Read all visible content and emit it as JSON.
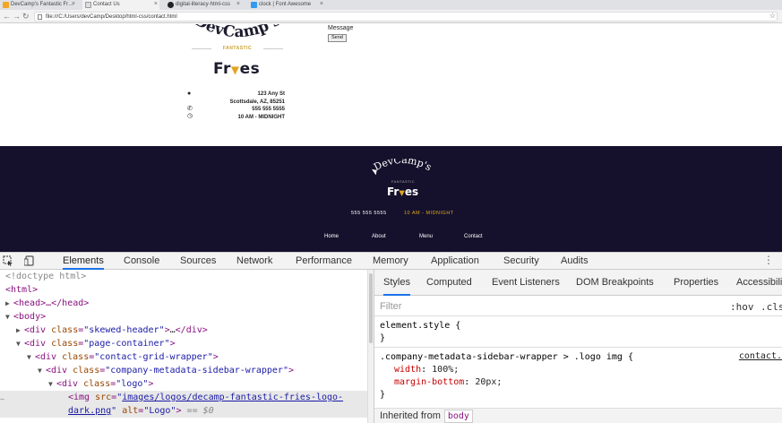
{
  "browser": {
    "tabs": [
      {
        "label": "DevCamp's Fantastic Fr…",
        "active": false
      },
      {
        "label": "Contact Us",
        "active": true
      },
      {
        "label": "digital-literacy-html-css",
        "active": false
      },
      {
        "label": "clock | Font Awesome",
        "active": false
      }
    ],
    "url": "file:///C:/Users/devCamp/Desktop/html-css/contact.html"
  },
  "page": {
    "brand_arc": "DevCamp's",
    "brand_tag": "FANTASTIC",
    "brand_main": "Fries",
    "address": [
      "123 Any St",
      "Scottsdale, AZ, 85251",
      "555 555 5555",
      "10 AM - MIDNIGHT"
    ],
    "message_label": "Message",
    "send_label": "Send",
    "footer": {
      "brand_arc": "DevCamp's",
      "brand_tag": "FANTASTIC",
      "brand_main": "Fries",
      "phone": "555 555 5555",
      "hours": "10 AM - MIDNIGHT",
      "nav": [
        "Home",
        "About",
        "Menu",
        "Contact"
      ]
    }
  },
  "devtools": {
    "tabs": [
      "Elements",
      "Console",
      "Sources",
      "Network",
      "Performance",
      "Memory",
      "Application",
      "Security",
      "Audits"
    ],
    "active_tab": "Elements",
    "dom": {
      "doctype": "<!doctype html>",
      "html": "<html>",
      "head": "<head>…</head>",
      "body": "<body>",
      "div1_class": "skewed-header",
      "div2_class": "page-container",
      "div3_class": "contact-grid-wrapper",
      "div4_class": "company-metadata-sidebar-wrapper",
      "div5_class": "logo",
      "img_src_1": "images/logos/decamp-fantastic-fries-logo-",
      "img_src_2": "dark.png",
      "img_alt": "Logo",
      "selected_marker": "== $0"
    },
    "styles_tabs": [
      "Styles",
      "Computed",
      "Event Listeners",
      "DOM Breakpoints",
      "Properties",
      "Accessibili"
    ],
    "filter_placeholder": "Filter",
    "filter_hov": ":hov",
    "filter_cls": ".cls",
    "element_style": "element.style {",
    "rule_selector": ".company-metadata-sidebar-wrapper > .logo img {",
    "rule_source": "contact.",
    "rule_props": [
      {
        "name": "width",
        "value": "100%;"
      },
      {
        "name": "margin-bottom",
        "value": "20px;"
      }
    ],
    "inherited_label": "Inherited from",
    "inherited_from": "body"
  }
}
